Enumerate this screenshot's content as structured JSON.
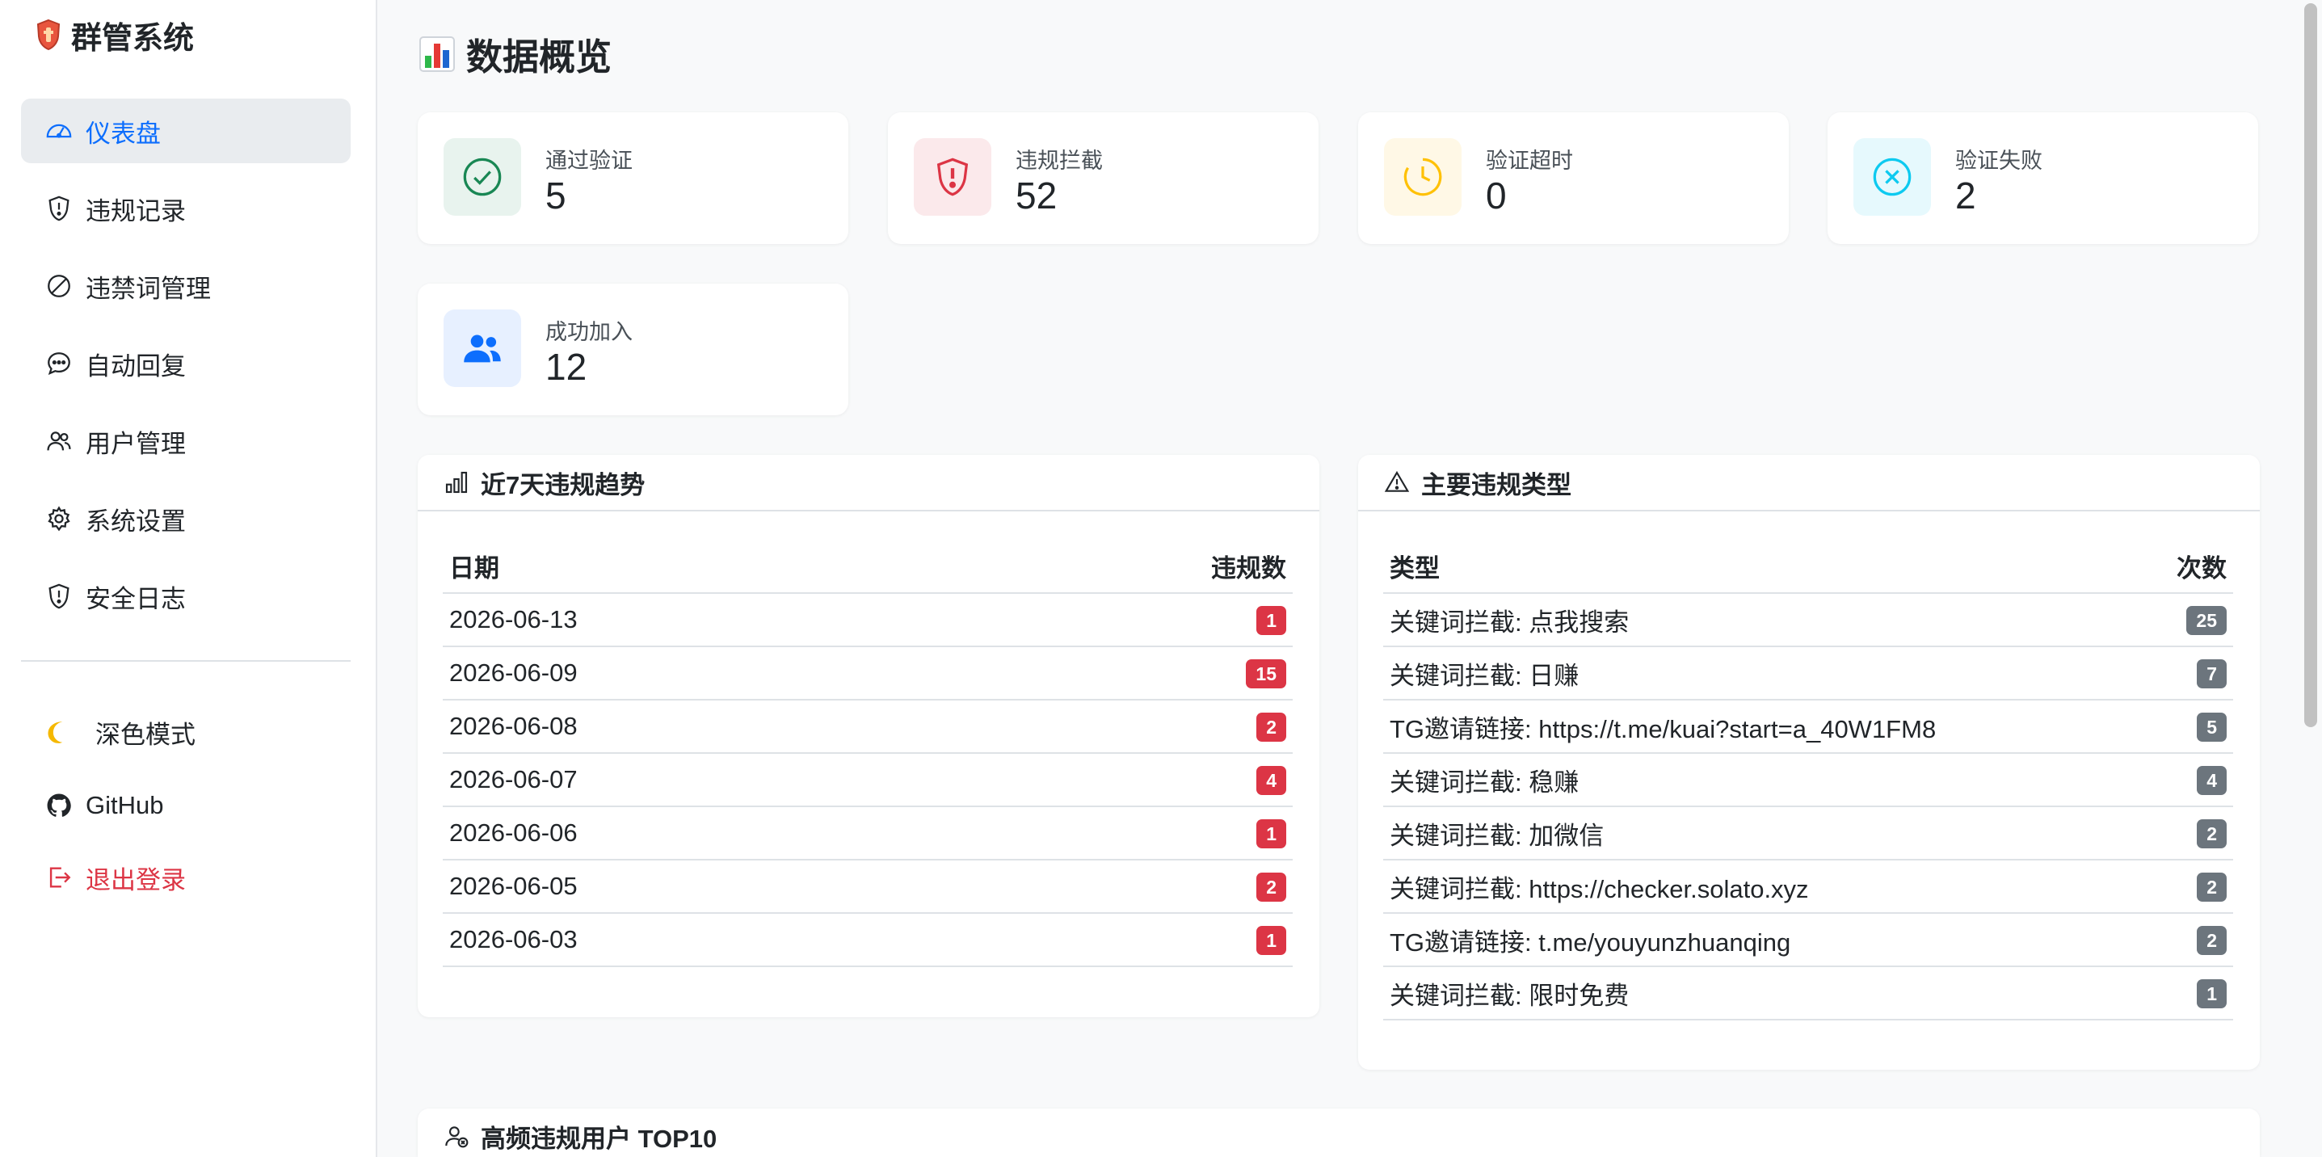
{
  "brand": {
    "title": "群管系统",
    "icon": "shield-logo-icon"
  },
  "sidebar": {
    "items": [
      {
        "label": "仪表盘",
        "icon": "dashboard-icon",
        "active": true
      },
      {
        "label": "违规记录",
        "icon": "shield-alert-icon"
      },
      {
        "label": "违禁词管理",
        "icon": "ban-icon"
      },
      {
        "label": "自动回复",
        "icon": "chat-icon"
      },
      {
        "label": "用户管理",
        "icon": "users-icon"
      },
      {
        "label": "系统设置",
        "icon": "gear-icon"
      },
      {
        "label": "安全日志",
        "icon": "shield-alert-icon"
      }
    ],
    "dark_mode": "深色模式",
    "github": "GitHub",
    "logout": "退出登录"
  },
  "page": {
    "title": "数据概览",
    "title_icon": "bar-chart-emoji-icon"
  },
  "stats": [
    {
      "label": "通过验证",
      "value": "5",
      "icon": "check-circle-icon",
      "color": "#198754",
      "bg": "#e8f3ee"
    },
    {
      "label": "违规拦截",
      "value": "52",
      "icon": "shield-exclamation-icon",
      "color": "#dc3545",
      "bg": "#fbe9eb"
    },
    {
      "label": "验证超时",
      "value": "0",
      "icon": "clock-icon",
      "color": "#ffc107",
      "bg": "#fff8e6"
    },
    {
      "label": "验证失败",
      "value": "2",
      "icon": "x-circle-icon",
      "color": "#0dcaf0",
      "bg": "#e6f9fd"
    },
    {
      "label": "成功加入",
      "value": "12",
      "icon": "people-icon",
      "color": "#0d6efd",
      "bg": "#e7f0ff"
    }
  ],
  "trend": {
    "title": "近7天违规趋势",
    "headers": [
      "日期",
      "违规数"
    ],
    "rows": [
      {
        "date": "2026-06-13",
        "count": "1"
      },
      {
        "date": "2026-06-09",
        "count": "15"
      },
      {
        "date": "2026-06-08",
        "count": "2"
      },
      {
        "date": "2026-06-07",
        "count": "4"
      },
      {
        "date": "2026-06-06",
        "count": "1"
      },
      {
        "date": "2026-06-05",
        "count": "2"
      },
      {
        "date": "2026-06-03",
        "count": "1"
      }
    ]
  },
  "types": {
    "title": "主要违规类型",
    "headers": [
      "类型",
      "次数"
    ],
    "rows": [
      {
        "type": "关键词拦截: 点我搜索",
        "count": "25"
      },
      {
        "type": "关键词拦截: 日赚",
        "count": "7"
      },
      {
        "type": "TG邀请链接: https://t.me/kuai?start=a_40W1FM8",
        "count": "5"
      },
      {
        "type": "关键词拦截: 稳赚",
        "count": "4"
      },
      {
        "type": "关键词拦截: 加微信",
        "count": "2"
      },
      {
        "type": "关键词拦截: https://checker.solato.xyz",
        "count": "2"
      },
      {
        "type": "TG邀请链接: t.me/youyunzhuanqing",
        "count": "2"
      },
      {
        "type": "关键词拦截: 限时免费",
        "count": "1"
      }
    ]
  },
  "top_users": {
    "title": "高频违规用户 TOP10"
  },
  "colors": {
    "accent": "#0d6efd",
    "danger": "#dc3545",
    "muted": "#6c757d"
  }
}
